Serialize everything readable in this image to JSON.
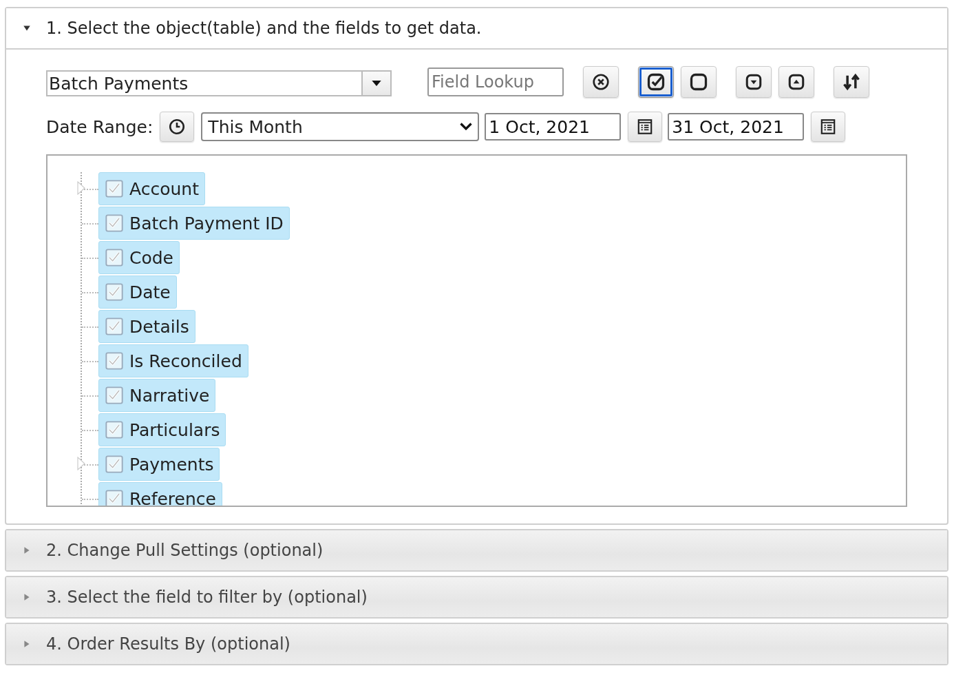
{
  "sections": [
    {
      "title": "1. Select the object(table) and the fields to get data.",
      "expanded": true
    },
    {
      "title": "2. Change Pull Settings (optional)",
      "expanded": false
    },
    {
      "title": "3. Select the field to filter by (optional)",
      "expanded": false
    },
    {
      "title": "4. Order Results By (optional)",
      "expanded": false
    }
  ],
  "object_select": {
    "value": "Batch Payments"
  },
  "field_lookup": {
    "placeholder": "Field Lookup"
  },
  "toolbar_groups": [
    [
      {
        "kind": "clear",
        "selected": false
      }
    ],
    [
      {
        "kind": "check_all",
        "selected": true
      },
      {
        "kind": "uncheck_all",
        "selected": false
      }
    ],
    [
      {
        "kind": "expand_all",
        "selected": false
      },
      {
        "kind": "collapse_all",
        "selected": false
      }
    ],
    [
      {
        "kind": "sort",
        "selected": false
      }
    ]
  ],
  "date_range": {
    "label": "Date Range:",
    "preset": "This Month",
    "from": "1 Oct, 2021",
    "to": "31 Oct, 2021"
  },
  "fields": [
    {
      "label": "Account",
      "checked": true,
      "selected": true,
      "expandable": true
    },
    {
      "label": "Batch Payment ID",
      "checked": true,
      "selected": true,
      "expandable": false
    },
    {
      "label": "Code",
      "checked": true,
      "selected": true,
      "expandable": false
    },
    {
      "label": "Date",
      "checked": true,
      "selected": true,
      "expandable": false
    },
    {
      "label": "Details",
      "checked": true,
      "selected": true,
      "expandable": false
    },
    {
      "label": "Is Reconciled",
      "checked": true,
      "selected": true,
      "expandable": false
    },
    {
      "label": "Narrative",
      "checked": true,
      "selected": true,
      "expandable": false
    },
    {
      "label": "Particulars",
      "checked": true,
      "selected": true,
      "expandable": false
    },
    {
      "label": "Payments",
      "checked": true,
      "selected": true,
      "expandable": true
    },
    {
      "label": "Reference",
      "checked": true,
      "selected": true,
      "expandable": false
    }
  ]
}
